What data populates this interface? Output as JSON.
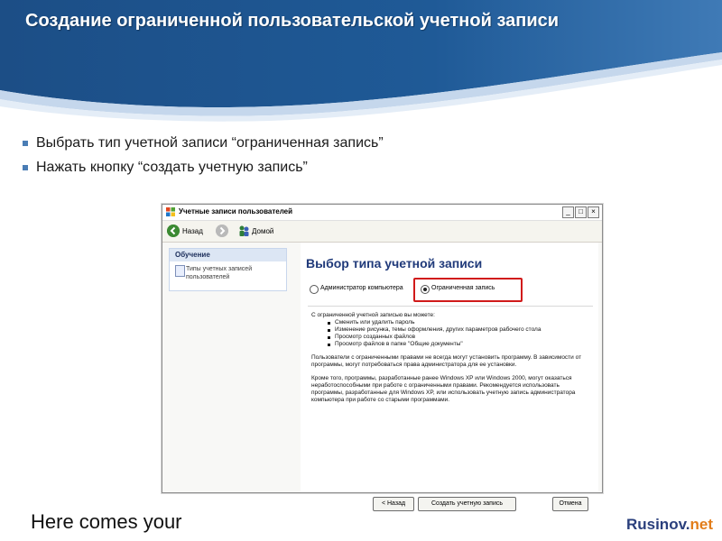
{
  "slide": {
    "title": "Создание ограниченной пользовательской учетной записи",
    "bullets": [
      "Выбрать тип учетной записи “ограниченная запись”",
      "Нажать кнопку “создать учетную запись”"
    ],
    "footer_text": "Here comes your",
    "brand": {
      "main": "Rusinov.",
      "tld": "net"
    },
    "colors": {
      "header_blue": "#1e4f86",
      "brand": "#2a3f7c",
      "brand_tld": "#e27d1a",
      "highlight": "#d11a1a"
    }
  },
  "window": {
    "title": "Учетные записи пользователей",
    "controls": [
      "_",
      "□",
      "×"
    ],
    "toolbar": {
      "back": "Назад",
      "home": "Домой"
    },
    "learn": {
      "header": "Обучение",
      "item": "Типы учетных записей пользователей"
    },
    "heading": "Выбор типа учетной записи",
    "options": [
      {
        "label": "Администратор компьютера",
        "selected": false
      },
      {
        "label": "Ограниченная запись",
        "selected": true
      }
    ],
    "intro": "С ограниченной учетной записью вы можете:",
    "capabilities": [
      "Сменить или удалить пароль",
      "Изменение рисунка, темы оформления, других параметров рабочего стола",
      "Просмотр созданных файлов",
      "Просмотр файлов в папке \"Общие документы\""
    ],
    "para1": "Пользователи с ограниченными правами не всегда могут установить программу. В зависимости от программы, могут потребоваться права администратора для ее установки.",
    "para2": "Кроме того, программы, разработанные ранее Windows XP или Windows 2000, могут оказаться неработоспособными при работе с ограниченными правами. Рекомендуется использовать программы, разработанные для Windows XP, или использовать учетную запись администратора компьютера при работе со старыми программами.",
    "buttons": {
      "back": "< Назад",
      "create": "Создать учетную запись",
      "cancel": "Отмена"
    }
  }
}
